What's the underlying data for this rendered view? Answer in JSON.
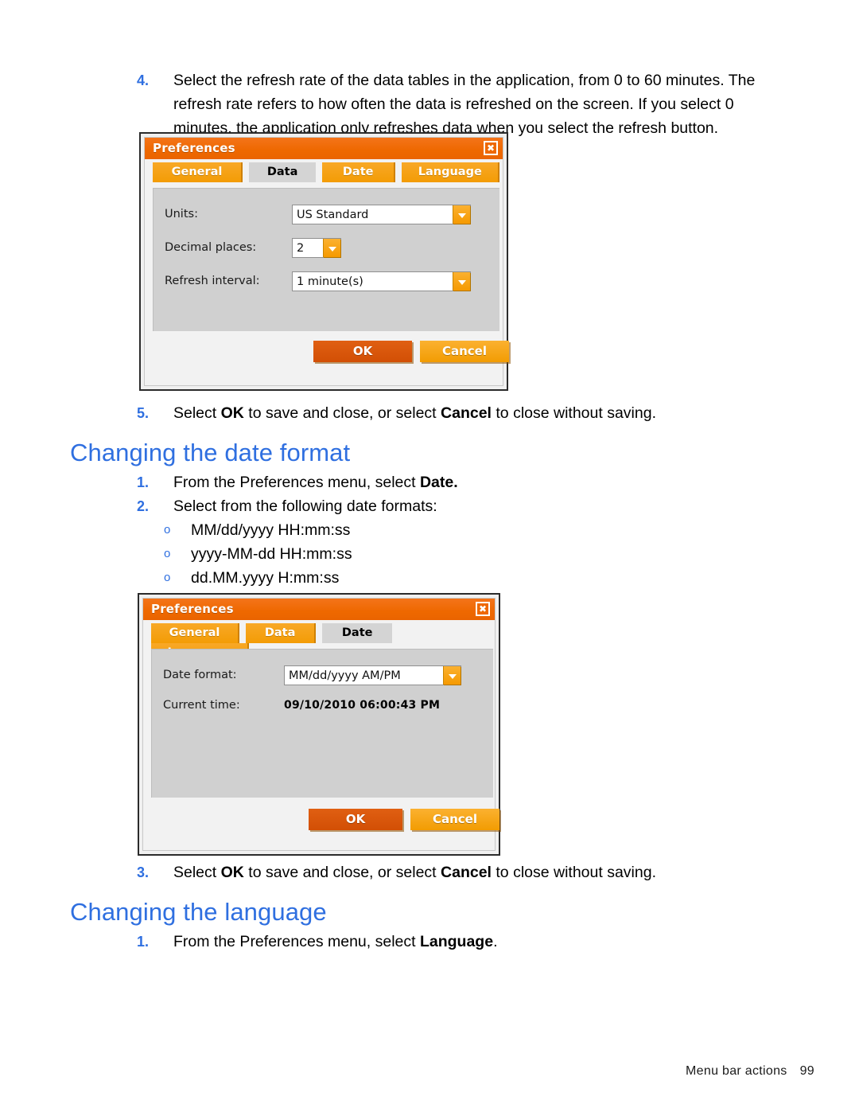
{
  "colors": {
    "heading_blue": "#2f6fe0",
    "title_orange": "#ee6800",
    "tab_amber": "#f39c05",
    "ok_orange": "#d24f05",
    "cancel_amber": "#f29c02",
    "panel_gray": "#d0d0d0"
  },
  "steps": {
    "step4": {
      "number": "4.",
      "text": "Select the refresh rate of the data tables in the application, from 0 to 60 minutes. The refresh rate refers to how often the data is refreshed on the screen. If you select 0 minutes, the application only refreshes data when you select the refresh button."
    },
    "step5": {
      "number": "5.",
      "prefix": "Select ",
      "bold1": "OK",
      "middle": " to save and close, or select ",
      "bold2": "Cancel",
      "suffix": " to close without saving."
    },
    "date_step1": {
      "number": "1.",
      "prefix": "From the Preferences menu, select ",
      "bold1": "Date."
    },
    "date_step2": {
      "number": "2.",
      "text": "Select from the following date formats:"
    },
    "date_step3": {
      "number": "3.",
      "prefix": "Select ",
      "bold1": "OK",
      "middle": " to save and close, or select ",
      "bold2": "Cancel",
      "suffix": " to close without saving."
    },
    "lang_step1": {
      "number": "1.",
      "prefix": "From the Preferences menu, select ",
      "bold1": "Language",
      "suffix": "."
    }
  },
  "date_format_bullets": {
    "marker": "o",
    "items": [
      "MM/dd/yyyy HH:mm:ss",
      "yyyy-MM-dd HH:mm:ss",
      "dd.MM.yyyy H:mm:ss"
    ]
  },
  "headings": {
    "date_format": "Changing the date format",
    "language": "Changing the language"
  },
  "dialog_data": {
    "title": "Preferences",
    "close_label": "✖",
    "tabs": [
      {
        "label": "General",
        "active": false
      },
      {
        "label": "Data",
        "active": true
      },
      {
        "label": "Date",
        "active": false
      },
      {
        "label": "Language",
        "active": false
      }
    ],
    "fields": {
      "units_label": "Units:",
      "units_value": "US Standard",
      "decimal_label": "Decimal places:",
      "decimal_value": "2",
      "refresh_label": "Refresh interval:",
      "refresh_value": "1 minute(s)"
    },
    "buttons": {
      "ok": "OK",
      "cancel": "Cancel"
    }
  },
  "dialog_date": {
    "title": "Preferences",
    "close_label": "✖",
    "tabs": [
      {
        "label": "General",
        "active": false
      },
      {
        "label": "Data",
        "active": false
      },
      {
        "label": "Date",
        "active": true
      },
      {
        "label": "Language",
        "active": false
      }
    ],
    "fields": {
      "format_label": "Date format:",
      "format_value": "MM/dd/yyyy AM/PM",
      "time_label": "Current time:",
      "time_value": "09/10/2010 06:00:43 PM"
    },
    "buttons": {
      "ok": "OK",
      "cancel": "Cancel"
    }
  },
  "footer": {
    "section": "Menu bar actions",
    "page": "99"
  }
}
